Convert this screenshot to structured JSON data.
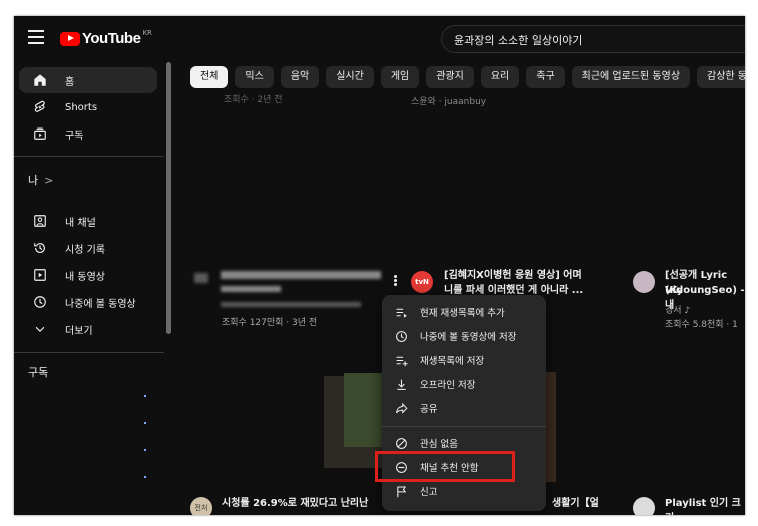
{
  "app": {
    "logo_text": "YouTube",
    "region": "KR"
  },
  "search": {
    "query": "윤과장의 소소한 일상이야기"
  },
  "sidebar": {
    "main": [
      {
        "label": "홈",
        "icon": "home-icon"
      },
      {
        "label": "Shorts",
        "icon": "shorts-icon"
      },
      {
        "label": "구독",
        "icon": "subscriptions-icon"
      }
    ],
    "me_header": "나",
    "me_arrow": ">",
    "you": [
      {
        "label": "내 채널",
        "icon": "channel-icon"
      },
      {
        "label": "시청 기록",
        "icon": "history-icon"
      },
      {
        "label": "내 동영상",
        "icon": "my-videos-icon"
      },
      {
        "label": "나중에 볼 동영상",
        "icon": "watch-later-icon"
      },
      {
        "label": "더보기",
        "icon": "chevron-down-icon"
      }
    ],
    "subscriptions_header": "구독"
  },
  "chips": [
    "전체",
    "믹스",
    "음악",
    "실시간",
    "게임",
    "관광지",
    "요리",
    "축구",
    "최근에 업로드된 동영상",
    "감상한 동영상"
  ],
  "videos": {
    "row1_channel": "스윤와 · juaanbuy",
    "row2_left_meta": "조회수 127만회 · 3년 전",
    "row2_mid_avatar": "tvN",
    "row2_mid_title_1": "[김혜지X이병헌 응원 영상] 어며",
    "row2_mid_title_2": "니를 파세 이러했던 게 아니라 ...",
    "row2_right_title_1": "[선공개 Lyric Vid",
    "row2_right_title_2": "(KyoungSeo) - 내",
    "row2_right_channel": "경서 ♪",
    "row2_right_meta": "조회수 5.8천회 · 1",
    "row3_mid_avatar": "전처",
    "row3_left_title": "시청률 26.9%로 재밌다고 난리난",
    "row3_mid_title": "생활기【얼",
    "row3_right_title": "Playlist 인기 크리"
  },
  "context_menu": {
    "items": [
      {
        "label": "현재 재생목록에 추가",
        "icon": "add-to-queue-icon"
      },
      {
        "label": "나중에 볼 동영상에 저장",
        "icon": "clock-icon"
      },
      {
        "label": "재생목록에 저장",
        "icon": "playlist-add-icon"
      },
      {
        "label": "오프라인 저장",
        "icon": "download-icon"
      },
      {
        "label": "공유",
        "icon": "share-icon"
      },
      {
        "label": "관심 없음",
        "icon": "not-interested-icon"
      },
      {
        "label": "채널 추천 안함",
        "icon": "block-channel-icon"
      },
      {
        "label": "신고",
        "icon": "flag-icon"
      }
    ]
  },
  "colors": {
    "background": "#0f0f0f",
    "accent_red": "#ff0000",
    "highlight_border": "#e0201b",
    "menu_bg": "#282828"
  }
}
